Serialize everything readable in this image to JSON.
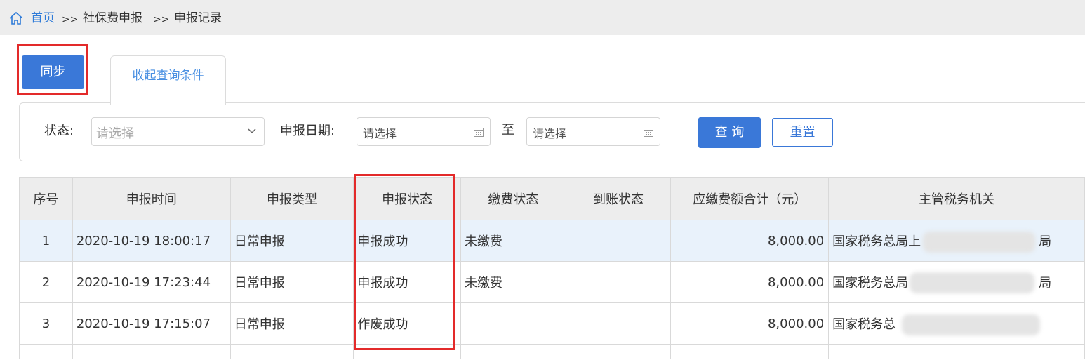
{
  "breadcrumb": {
    "home": "首页",
    "sep": ">>",
    "level2": "社保费申报",
    "current": "申报记录"
  },
  "toolbar": {
    "sync_label": "同步"
  },
  "tab": {
    "label": "收起查询条件"
  },
  "query": {
    "status_label": "状态:",
    "status_placeholder": "请选择",
    "date_label": "申报日期:",
    "date_from_placeholder": "请选择",
    "to_label": "至",
    "date_to_placeholder": "请选择",
    "query_button": "查 询",
    "reset_button": "重置"
  },
  "table": {
    "headers": [
      "序号",
      "申报时间",
      "申报类型",
      "申报状态",
      "缴费状态",
      "到账状态",
      "应缴费额合计（元）",
      "主管税务机关"
    ],
    "rows": [
      {
        "index": "1",
        "time": "2020-10-19 18:00:17",
        "type": "日常申报",
        "status": "申报成功",
        "pay_status": "未缴费",
        "arrival_status": "",
        "amount": "8,000.00",
        "authority": "国家税务总局上",
        "authority_tail": "局"
      },
      {
        "index": "2",
        "time": "2020-10-19 17:23:44",
        "type": "日常申报",
        "status": "申报成功",
        "pay_status": "未缴费",
        "arrival_status": "",
        "amount": "8,000.00",
        "authority": "国家税务总局",
        "authority_tail": "局"
      },
      {
        "index": "3",
        "time": "2020-10-19 17:15:07",
        "type": "日常申报",
        "status": "作废成功",
        "pay_status": "",
        "arrival_status": "",
        "amount": "8,000.00",
        "authority": "国家税务总",
        "authority_tail": ""
      }
    ]
  },
  "colors": {
    "primary": "#3a78d8",
    "link": "#2f7bd8",
    "highlight_border": "#e32a2a",
    "selected_row": "#e9f2fb"
  }
}
